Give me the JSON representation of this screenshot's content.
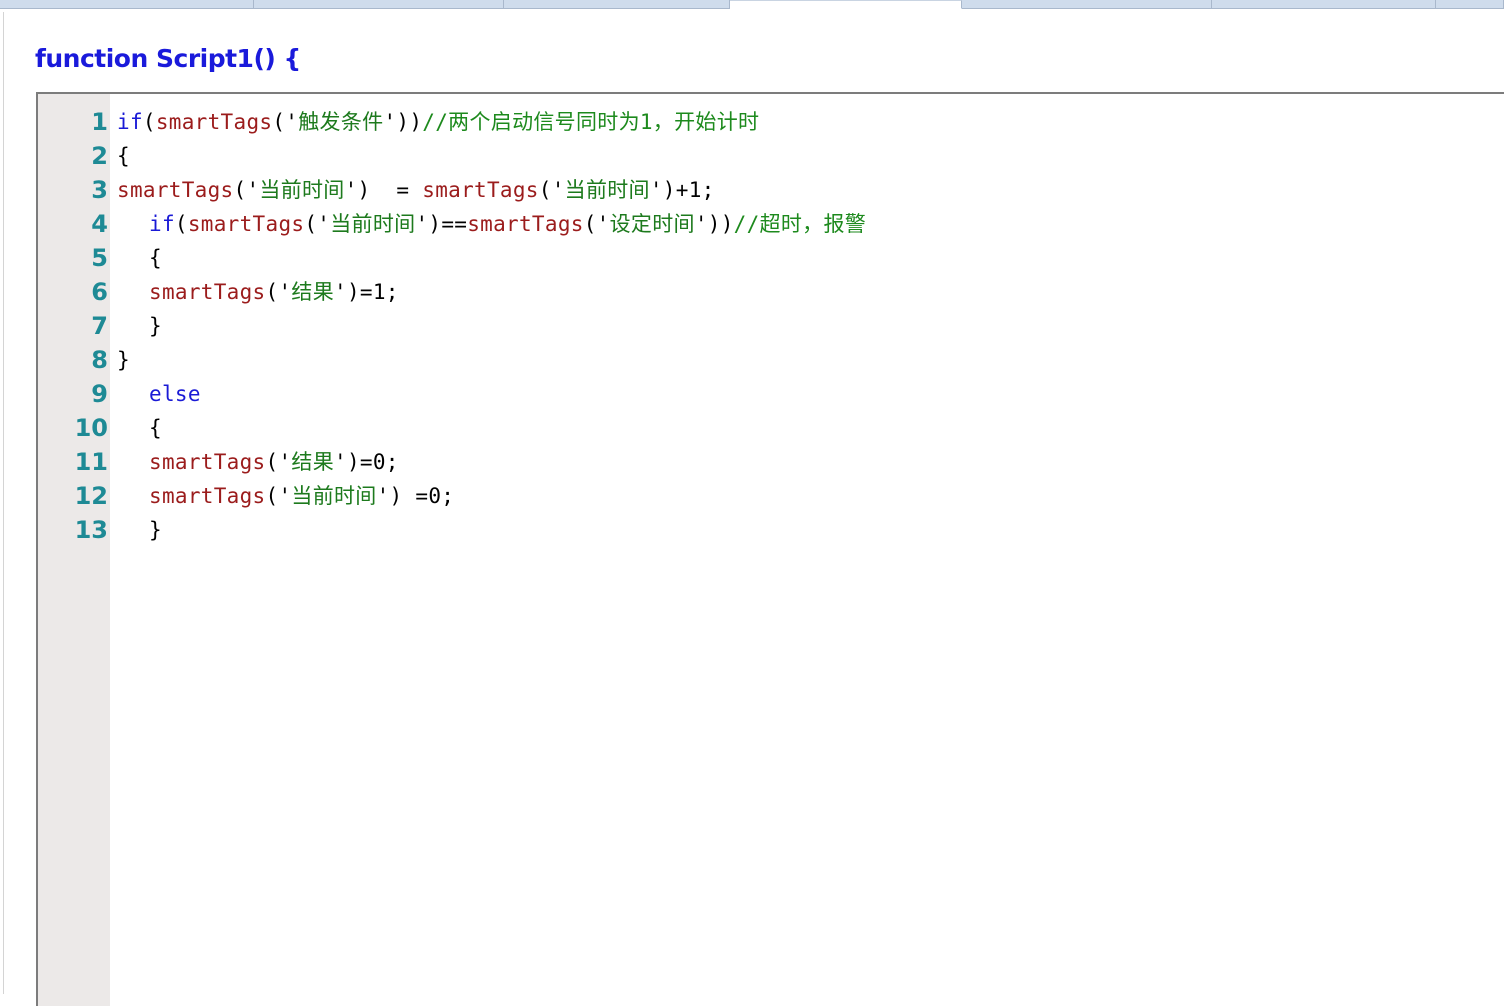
{
  "tabs": [
    {
      "label": ""
    },
    {
      "label": ""
    },
    {
      "label": ""
    },
    {
      "label": "",
      "active": true
    },
    {
      "label": ""
    },
    {
      "label": ""
    },
    {
      "label": ""
    }
  ],
  "function_header": "function Script1() {",
  "code_lines": [
    {
      "num": "1",
      "indent": 0,
      "tokens": [
        [
          "kw",
          "if"
        ],
        [
          "pun",
          "("
        ],
        [
          "fn",
          "smartTags"
        ],
        [
          "pun",
          "('"
        ],
        [
          "str",
          "触发条件"
        ],
        [
          "pun",
          "'))"
        ],
        [
          "cmt",
          "//两个启动信号同时为1，开始计时"
        ]
      ]
    },
    {
      "num": "2",
      "indent": 0,
      "tokens": [
        [
          "pun",
          "{"
        ]
      ]
    },
    {
      "num": "3",
      "indent": 0,
      "tokens": [
        [
          "fn",
          "smartTags"
        ],
        [
          "pun",
          "('"
        ],
        [
          "str",
          "当前时间"
        ],
        [
          "pun",
          "')  = "
        ],
        [
          "fn",
          "smartTags"
        ],
        [
          "pun",
          "('"
        ],
        [
          "str",
          "当前时间"
        ],
        [
          "pun",
          "')+1;"
        ]
      ]
    },
    {
      "num": "4",
      "indent": 1,
      "tokens": [
        [
          "kw",
          "if"
        ],
        [
          "pun",
          "("
        ],
        [
          "fn",
          "smartTags"
        ],
        [
          "pun",
          "('"
        ],
        [
          "str",
          "当前时间"
        ],
        [
          "pun",
          "')=="
        ],
        [
          "fn",
          "smartTags"
        ],
        [
          "pun",
          "('"
        ],
        [
          "str",
          "设定时间"
        ],
        [
          "pun",
          "'))"
        ],
        [
          "cmt",
          "//超时，报警"
        ]
      ]
    },
    {
      "num": "5",
      "indent": 1,
      "tokens": [
        [
          "pun",
          "{"
        ]
      ]
    },
    {
      "num": "6",
      "indent": 1,
      "tokens": [
        [
          "fn",
          "smartTags"
        ],
        [
          "pun",
          "('"
        ],
        [
          "str",
          "结果"
        ],
        [
          "pun",
          "')=1;"
        ]
      ]
    },
    {
      "num": "7",
      "indent": 1,
      "tokens": [
        [
          "pun",
          "}"
        ]
      ]
    },
    {
      "num": "8",
      "indent": 0,
      "tokens": [
        [
          "pun",
          "}"
        ]
      ]
    },
    {
      "num": "9",
      "indent": 1,
      "tokens": [
        [
          "kw",
          "else"
        ]
      ]
    },
    {
      "num": "10",
      "indent": 1,
      "tokens": [
        [
          "pun",
          "{"
        ]
      ]
    },
    {
      "num": "11",
      "indent": 1,
      "tokens": [
        [
          "fn",
          "smartTags"
        ],
        [
          "pun",
          "('"
        ],
        [
          "str",
          "结果"
        ],
        [
          "pun",
          "')=0;"
        ]
      ]
    },
    {
      "num": "12",
      "indent": 1,
      "tokens": [
        [
          "fn",
          "smartTags"
        ],
        [
          "pun",
          "('"
        ],
        [
          "str",
          "当前时间"
        ],
        [
          "pun",
          "') =0;"
        ]
      ]
    },
    {
      "num": "13",
      "indent": 1,
      "tokens": [
        [
          "pun",
          "}"
        ]
      ]
    }
  ],
  "colors": {
    "keyword": "#1a1ad6",
    "function": "#9b1c1c",
    "string": "#1d7a1d",
    "comment": "#1d8a1d",
    "line_number": "#1e8a95",
    "header": "#1a1adb",
    "gutter": "#ece9e8"
  }
}
